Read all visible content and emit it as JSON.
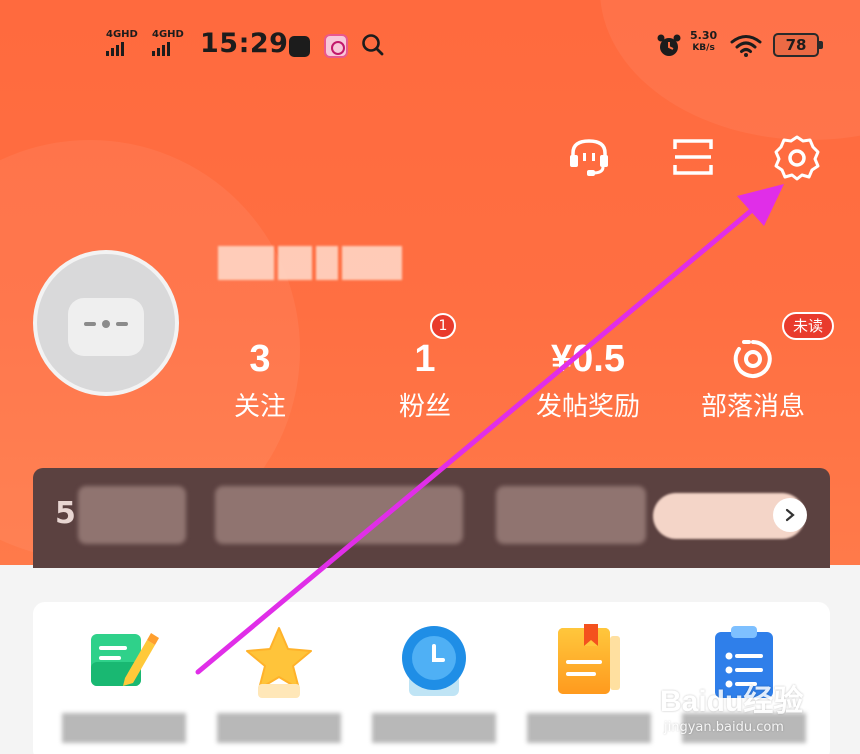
{
  "status_bar": {
    "signal1": "4GHD",
    "signal2": "4GHD",
    "time": "15:29",
    "net_speed_value": "5.30",
    "net_speed_unit": "KB/s",
    "battery": "78"
  },
  "top_actions": {
    "icons": [
      "customer-service-icon",
      "scan-icon",
      "settings-icon"
    ]
  },
  "profile": {
    "avatar_icon": "robot-avatar-icon"
  },
  "stats": [
    {
      "value": "3",
      "label": "关注"
    },
    {
      "value": "1",
      "label": "粉丝",
      "badge": "1"
    },
    {
      "value": "¥0.5",
      "label": "发帖奖励"
    },
    {
      "icon": "message-icon",
      "label": "部落消息",
      "badge": "未读"
    }
  ],
  "banner": {
    "lead": "5"
  },
  "tools": {
    "icons": [
      "write-post-icon",
      "favorite-star-icon",
      "history-clock-icon",
      "notebook-icon",
      "clipboard-icon"
    ]
  },
  "watermark": {
    "brand": "Baidu经验",
    "url": "jingyan.baidu.com"
  },
  "colors": {
    "header_bg": "#ff6a3e",
    "badge_red": "#e93b2c",
    "banner_bg": "#5b4140",
    "annotation_arrow": "#e02ee8"
  }
}
